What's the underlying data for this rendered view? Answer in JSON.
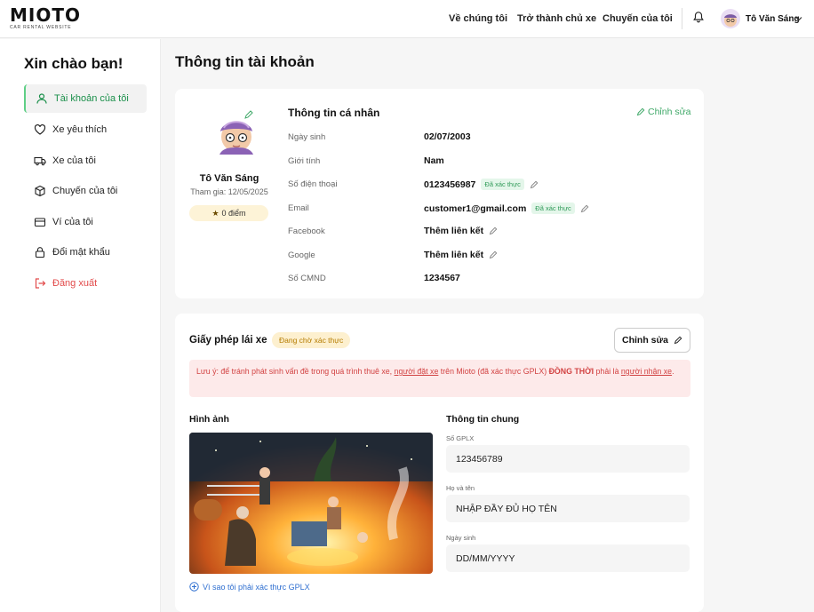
{
  "header": {
    "logo_main": "MIOTO",
    "logo_sub": "CAR RENTAL WEBSITE",
    "nav": [
      "Về chúng tôi",
      "Trở thành chủ xe",
      "Chuyến của tôi"
    ],
    "user_name": "Tô Văn Sáng"
  },
  "sidebar": {
    "greeting": "Xin chào bạn!",
    "items": [
      {
        "label": "Tài khoản của tôi",
        "icon": "user-icon"
      },
      {
        "label": "Xe yêu thích",
        "icon": "heart-icon"
      },
      {
        "label": "Xe của tôi",
        "icon": "truck-icon"
      },
      {
        "label": "Chuyến của tôi",
        "icon": "box-icon"
      },
      {
        "label": "Ví của tôi",
        "icon": "wallet-icon"
      },
      {
        "label": "Đổi mật khẩu",
        "icon": "lock-icon"
      },
      {
        "label": "Đăng xuất",
        "icon": "logout-icon"
      }
    ]
  },
  "page_title": "Thông tin tài khoản",
  "profile": {
    "name": "Tô Văn Sáng",
    "joined": "Tham gia: 12/05/2025",
    "points": "0 điểm"
  },
  "personal": {
    "title": "Thông tin cá nhân",
    "edit_label": "Chỉnh sửa",
    "verified_label": "Đã xác thực",
    "rows": {
      "dob": {
        "label": "Ngày sinh",
        "value": "02/07/2003"
      },
      "gender": {
        "label": "Giới tính",
        "value": "Nam"
      },
      "phone": {
        "label": "Số điện thoại",
        "value": "0123456987"
      },
      "email": {
        "label": "Email",
        "value": "customer1@gmail.com"
      },
      "facebook": {
        "label": "Facebook",
        "value": "Thêm liên kết"
      },
      "google": {
        "label": "Google",
        "value": "Thêm liên kết"
      },
      "id_card": {
        "label": "Số CMND",
        "value": "1234567"
      }
    }
  },
  "license": {
    "title": "Giấy phép lái xe",
    "status": "Đang chờ xác thực",
    "edit_label": "Chỉnh sửa",
    "note": {
      "p1": "Lưu ý: để tránh phát sinh vấn đề trong quá trình thuê xe, ",
      "u1": "người đặt xe",
      "p2": " trên Mioto (đã xác thực GPLX) ",
      "b1": "ĐỒNG THỜI",
      "p3": " phải là ",
      "u2": "người nhận xe",
      "p4": "."
    },
    "image_title": "Hình ảnh",
    "why_link": "Vì sao tôi phải xác thực GPLX",
    "info_title": "Thông tin chung",
    "fields": {
      "number": {
        "label": "Số GPLX",
        "value": "123456789"
      },
      "fullname": {
        "label": "Họ và tên",
        "value": "NHẬP ĐẦY ĐỦ HỌ TÊN"
      },
      "dob": {
        "label": "Ngày sinh",
        "value": "DD/MM/YYYY"
      }
    }
  },
  "colors": {
    "accent": "#5fcf86",
    "danger": "#e24a4a",
    "link": "#2f6fd0"
  }
}
